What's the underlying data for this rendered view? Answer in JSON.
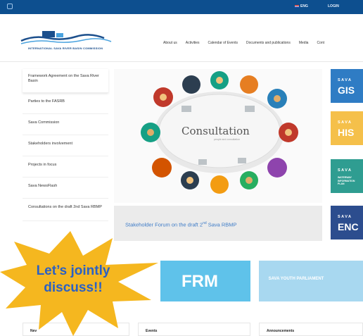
{
  "topbar": {
    "language": "ENG",
    "login": "LOGIN"
  },
  "logo": {
    "text": "INTERNATIONAL SAVA RIVER BASIN COMMISSION"
  },
  "nav": [
    "About us",
    "Activities",
    "Calendar of Events",
    "Documents and publications",
    "Media",
    "Cont"
  ],
  "sidebar": [
    "Framework Agreement on the Sava River Basin",
    "Parties to the FASRB",
    "Sava Commission",
    "Stakeholders involvement",
    "Projects in focus",
    "Sava NewsFlash",
    "Consultations on the draft 2nd Sava RBMP"
  ],
  "hero": {
    "title": "Consultation",
    "subtitle": "people and consultation"
  },
  "caption": {
    "text_before": "Stakeholder Forum on the draft 2",
    "sup": "nd",
    "text_after": " Sava RBMP"
  },
  "tiles": {
    "gis_small": "SAVA",
    "gis_big": "GIS",
    "his_small": "SAVA",
    "his_big": "HIS",
    "wat_small": "SAVA",
    "wat_tiny": "WATERWAY INFORMATION PLAN",
    "enc_small": "SAVA",
    "enc_big": "ENC"
  },
  "bands": {
    "frm": "FRM",
    "youth": "SAVA YOUTH PARLIAMENT"
  },
  "bottom": {
    "news": "Nev",
    "events": "Events",
    "announcements": "Announcements"
  },
  "burst": {
    "line1": "Let’s jointly",
    "line2": "discuss!!"
  },
  "colors": {
    "topbar": "#0d4f8f",
    "burst": "#f5b71f",
    "burst_text": "#2b61c4",
    "caption_link": "#3d7bc7"
  }
}
